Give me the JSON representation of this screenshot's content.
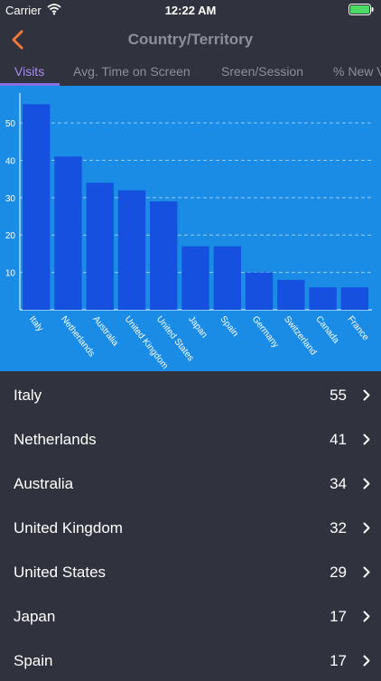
{
  "status_bar": {
    "carrier": "Carrier",
    "time": "12:22 AM"
  },
  "nav": {
    "title": "Country/Territory"
  },
  "tabs": [
    {
      "label": "Visits",
      "active": true
    },
    {
      "label": "Avg. Time on Screen",
      "active": false
    },
    {
      "label": "Sreen/Session",
      "active": false
    },
    {
      "label": "% New V",
      "active": false
    }
  ],
  "colors": {
    "accent": "#f07a3a",
    "tab_active": "#a98cf0",
    "chart_bg": "#1a8ce6",
    "bar_fill": "#1550de",
    "list_bg": "#30323d"
  },
  "chart_data": {
    "type": "bar",
    "categories": [
      "Italy",
      "Netherlands",
      "Australia",
      "United Kingdom",
      "United States",
      "Japan",
      "Spain",
      "Germany",
      "Switzerland",
      "Canada",
      "France"
    ],
    "values": [
      55,
      41,
      34,
      32,
      29,
      17,
      17,
      10,
      8,
      6,
      6
    ],
    "title": "",
    "xlabel": "",
    "ylabel": "",
    "ylim": [
      0,
      58
    ],
    "yticks": [
      10,
      20,
      30,
      40,
      50
    ],
    "grid": "horizontal-dashed"
  },
  "list": [
    {
      "name": "Italy",
      "value": "55"
    },
    {
      "name": "Netherlands",
      "value": "41"
    },
    {
      "name": "Australia",
      "value": "34"
    },
    {
      "name": "United Kingdom",
      "value": "32"
    },
    {
      "name": "United States",
      "value": "29"
    },
    {
      "name": "Japan",
      "value": "17"
    },
    {
      "name": "Spain",
      "value": "17"
    }
  ]
}
